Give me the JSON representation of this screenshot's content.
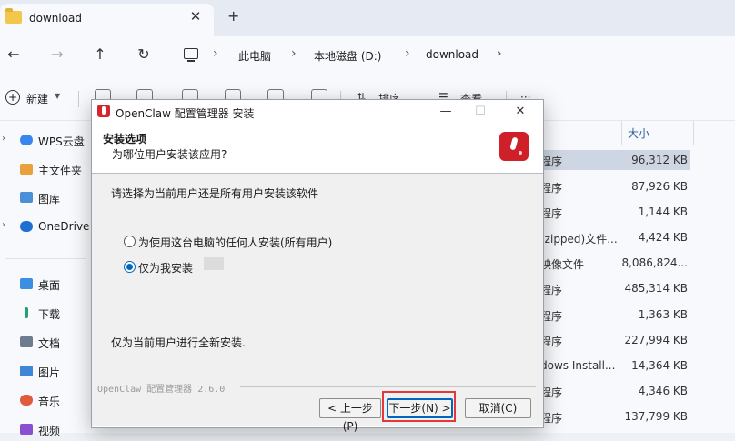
{
  "explorer": {
    "tab_title": "download",
    "tab_close": "✕",
    "new_tab": "+",
    "nav": {
      "back": "←",
      "forward": "→",
      "up": "↑",
      "refresh": "↻"
    },
    "breadcrumb": [
      "此电脑",
      "本地磁盘 (D:)",
      "download"
    ],
    "breadcrumb_sep": "›",
    "toolbar": {
      "new_label": "新建",
      "sort_label": "排序",
      "view_label": "查看",
      "more": "···"
    },
    "sidebar": [
      {
        "label": "WPS云盘",
        "chevron": "›"
      },
      {
        "label": "主文件夹",
        "chevron": ""
      },
      {
        "label": "图库",
        "chevron": ""
      },
      {
        "label": "OneDrive",
        "chevron": "›"
      },
      {
        "label": "桌面",
        "chevron": ""
      },
      {
        "label": "下载",
        "chevron": ""
      },
      {
        "label": "文档",
        "chevron": ""
      },
      {
        "label": "图片",
        "chevron": ""
      },
      {
        "label": "音乐",
        "chevron": ""
      },
      {
        "label": "视频",
        "chevron": ""
      }
    ],
    "column_size": "大小",
    "files": [
      {
        "type": "程序",
        "size": "96,312 KB",
        "selected": true
      },
      {
        "type": "程序",
        "size": "87,926 KB"
      },
      {
        "type": "程序",
        "size": "1,144 KB"
      },
      {
        "type": "(zipped)文件...",
        "size": "4,424 KB"
      },
      {
        "type": "映像文件",
        "size": "8,086,824..."
      },
      {
        "type": "程序",
        "size": "485,314 KB"
      },
      {
        "type": "程序",
        "size": "1,363 KB"
      },
      {
        "type": "程序",
        "size": "227,994 KB"
      },
      {
        "type": "dows Install...",
        "size": "14,364 KB"
      },
      {
        "type": "程序",
        "size": "4,346 KB"
      },
      {
        "type": "程序",
        "size": "137,799 KB"
      }
    ]
  },
  "installer": {
    "window_title": "OpenClaw 配置管理器 安装",
    "window_buttons": {
      "minimize": "—",
      "maximize": "☐",
      "close": "✕"
    },
    "header_title": "安装选项",
    "header_subtitle": "为哪位用户安装该应用?",
    "instruction": "请选择为当前用户还是所有用户安装该软件",
    "options": [
      {
        "label": "为使用这台电脑的任何人安装(所有用户)",
        "checked": false
      },
      {
        "label": "仅为我安装",
        "checked": true
      }
    ],
    "description": "仅为当前用户进行全新安装.",
    "branding": "OpenClaw 配置管理器 2.6.0",
    "buttons": {
      "back": "< 上一步(P)",
      "next": "下一步(N) >",
      "cancel": "取消(C)"
    }
  },
  "colors": {
    "accent": "#0067c0",
    "highlight": "#e5383b",
    "logo": "#cf1f29"
  }
}
